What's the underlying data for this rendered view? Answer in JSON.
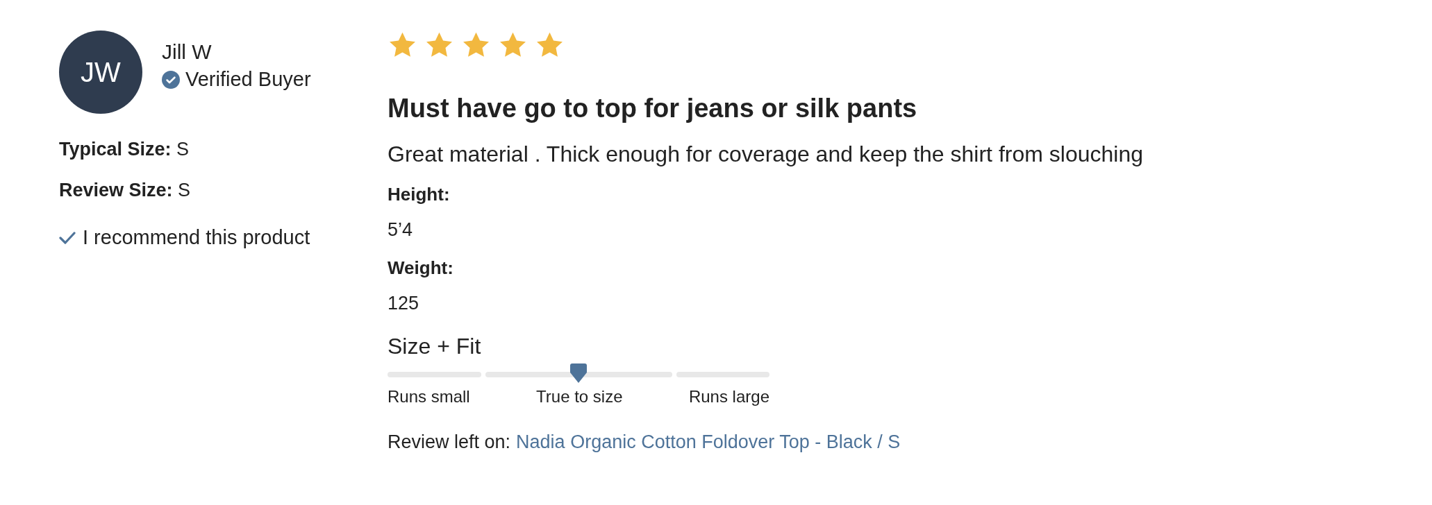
{
  "reviewer": {
    "initials": "JW",
    "name": "Jill W",
    "verified": true,
    "badge": "Verified Buyer"
  },
  "sizes": [
    {
      "label": "Typical Size:",
      "value": "S"
    },
    {
      "label": "Review Size:",
      "value": "S"
    }
  ],
  "recommend": {
    "checked": true,
    "text": "I recommend this product"
  },
  "review": {
    "stars": 5,
    "title": "Must have go to top for jeans or silk pants",
    "body": "Great material . Thick enough for coverage and keep the shirt from slouching"
  },
  "attributes": [
    {
      "label": "Height:",
      "value": "5’4"
    },
    {
      "label": "Weight:",
      "value": "125"
    }
  ],
  "fit": {
    "title": "Size + Fit",
    "level": 0.5,
    "labels": [
      "Runs small",
      "True to size",
      "Runs large"
    ]
  },
  "review_left_on": {
    "label": "Review left on:",
    "link": "Nadia Organic Cotton Foldover Top - Black / S"
  }
}
